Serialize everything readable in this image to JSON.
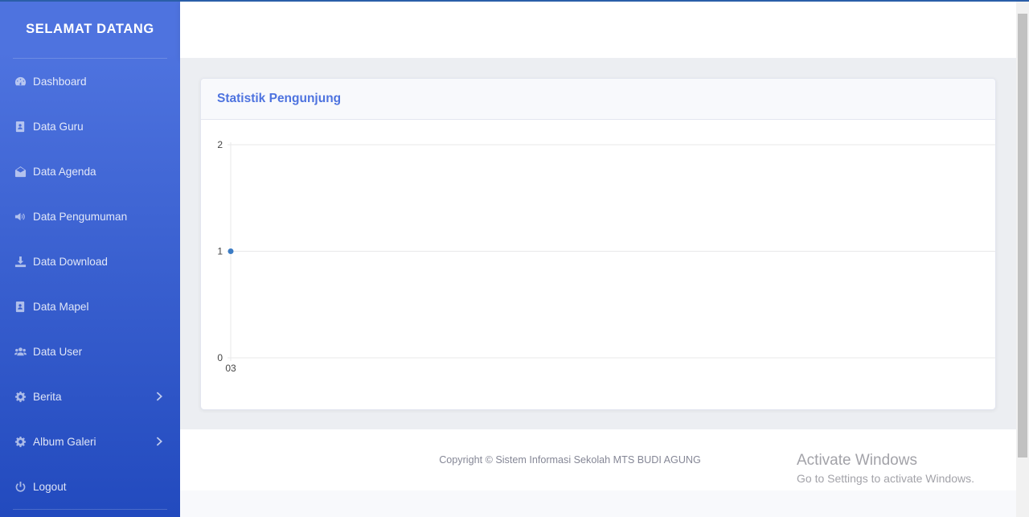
{
  "sidebar": {
    "brand": "SELAMAT DATANG",
    "items": [
      {
        "label": "Dashboard",
        "icon": "gauge-icon"
      },
      {
        "label": "Data Guru",
        "icon": "address-book-icon"
      },
      {
        "label": "Data Agenda",
        "icon": "envelope-open-icon"
      },
      {
        "label": "Data Pengumuman",
        "icon": "volume-icon"
      },
      {
        "label": "Data Download",
        "icon": "download-icon"
      },
      {
        "label": "Data Mapel",
        "icon": "address-book-icon"
      },
      {
        "label": "Data User",
        "icon": "users-icon"
      },
      {
        "label": "Berita",
        "icon": "gear-icon",
        "has_submenu": true
      },
      {
        "label": "Album Galeri",
        "icon": "gear-icon",
        "has_submenu": true
      },
      {
        "label": "Logout",
        "icon": "power-icon"
      }
    ]
  },
  "card": {
    "title": "Statistik Pengunjung"
  },
  "chart_data": {
    "type": "line",
    "title": "",
    "xlabel": "",
    "ylabel": "",
    "categories": [
      "03"
    ],
    "series": [
      {
        "values": [
          1
        ]
      }
    ],
    "y_ticks": [
      "0",
      "1",
      "2"
    ],
    "ylim": [
      0,
      2
    ],
    "grid": true,
    "color": "#4e73df"
  },
  "footer": {
    "text": "Copyright © Sistem Informasi Sekolah MTS BUDI AGUNG"
  },
  "watermark": {
    "title": "Activate Windows",
    "subtitle": "Go to Settings to activate Windows."
  },
  "colors": {
    "primary": "#4e73df",
    "sidebar_gradient_end": "#224abe"
  }
}
